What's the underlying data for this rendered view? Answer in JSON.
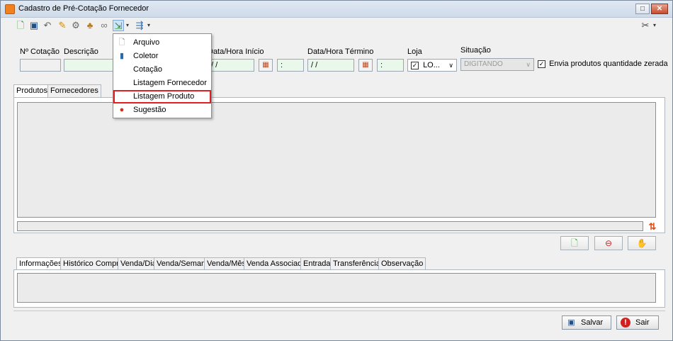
{
  "window": {
    "title": "Cadastro de Pré-Cotação Fornecedor"
  },
  "toolbar": {
    "icons": [
      "new-doc-icon",
      "save-icon",
      "undo-icon",
      "edit-icon",
      "gear-icon",
      "people-icon",
      "link-icon",
      "import-icon",
      "export-icon",
      "tools-icon"
    ]
  },
  "form": {
    "labels": {
      "num_cotacao": "Nº Cotação",
      "descricao": "Descrição",
      "data_inicio": "Data/Hora Início",
      "data_termino": "Data/Hora Término",
      "loja": "Loja",
      "situacao": "Situação"
    },
    "data_inicio_value": "/ /",
    "hora_inicio_value": ":",
    "data_termino_value": "/ /",
    "hora_termino_value": ":",
    "loja_value": "LO...",
    "situacao_value": "DIGITANDO",
    "envia_zerada_label": "Envia produtos quantidade zerada"
  },
  "tabs_top": [
    "Produtos",
    "Fornecedores"
  ],
  "tabs_bottom": [
    "Informações",
    "Histórico Compra",
    "Venda/Dia",
    "Venda/Semana",
    "Venda/Mês",
    "Venda Associado",
    "Entrada",
    "Transferência",
    "Observação"
  ],
  "dropdown": {
    "items": [
      {
        "label": "Arquivo",
        "icon": "file-icon"
      },
      {
        "label": "Coletor",
        "icon": "scanner-icon"
      },
      {
        "label": "Cotação",
        "icon": ""
      },
      {
        "label": "Listagem Fornecedor",
        "icon": ""
      },
      {
        "label": "Listagem Produto",
        "icon": ""
      },
      {
        "label": "Sugestão",
        "icon": "suggestion-icon"
      }
    ]
  },
  "buttons": {
    "salvar": "Salvar",
    "sair": "Sair"
  },
  "colors": {
    "highlight_border": "#e02020",
    "field_green": "#e9f8ea",
    "sort_icon": "#e0501a"
  }
}
